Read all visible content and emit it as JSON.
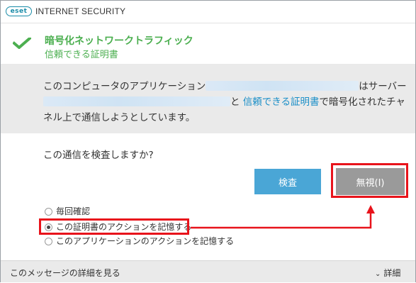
{
  "app": {
    "logo_text": "eset",
    "title": "INTERNET SECURITY"
  },
  "header": {
    "title": "暗号化ネットワークトラフィック",
    "subtitle": "信頼できる証明書",
    "icon": "check-icon",
    "accent": "#4caf50"
  },
  "message": {
    "part1": "このコンピュータのアプリケーション",
    "part2": "はサーバー",
    "part3": "と",
    "link": "信頼できる証明書",
    "part4": "で暗号化されたチャネル上で通信しようとしています。"
  },
  "question": "この通信を検査しますか?",
  "buttons": {
    "inspect": "検査",
    "ignore": "無視(I)"
  },
  "radios": [
    {
      "label": "毎回確認",
      "checked": false
    },
    {
      "label": "この証明書のアクションを記憶する",
      "checked": true
    },
    {
      "label": "このアプリケーションのアクションを記憶する",
      "checked": false
    }
  ],
  "footer": {
    "details_link": "このメッセージの詳細を見る",
    "details_toggle": "詳細",
    "chevron_icon": "chevron-down-icon"
  },
  "colors": {
    "link": "#1b8fc8",
    "inspect_button": "#4aa6d6",
    "ignore_button": "#9a9a9a",
    "highlight": "#e8131b"
  }
}
